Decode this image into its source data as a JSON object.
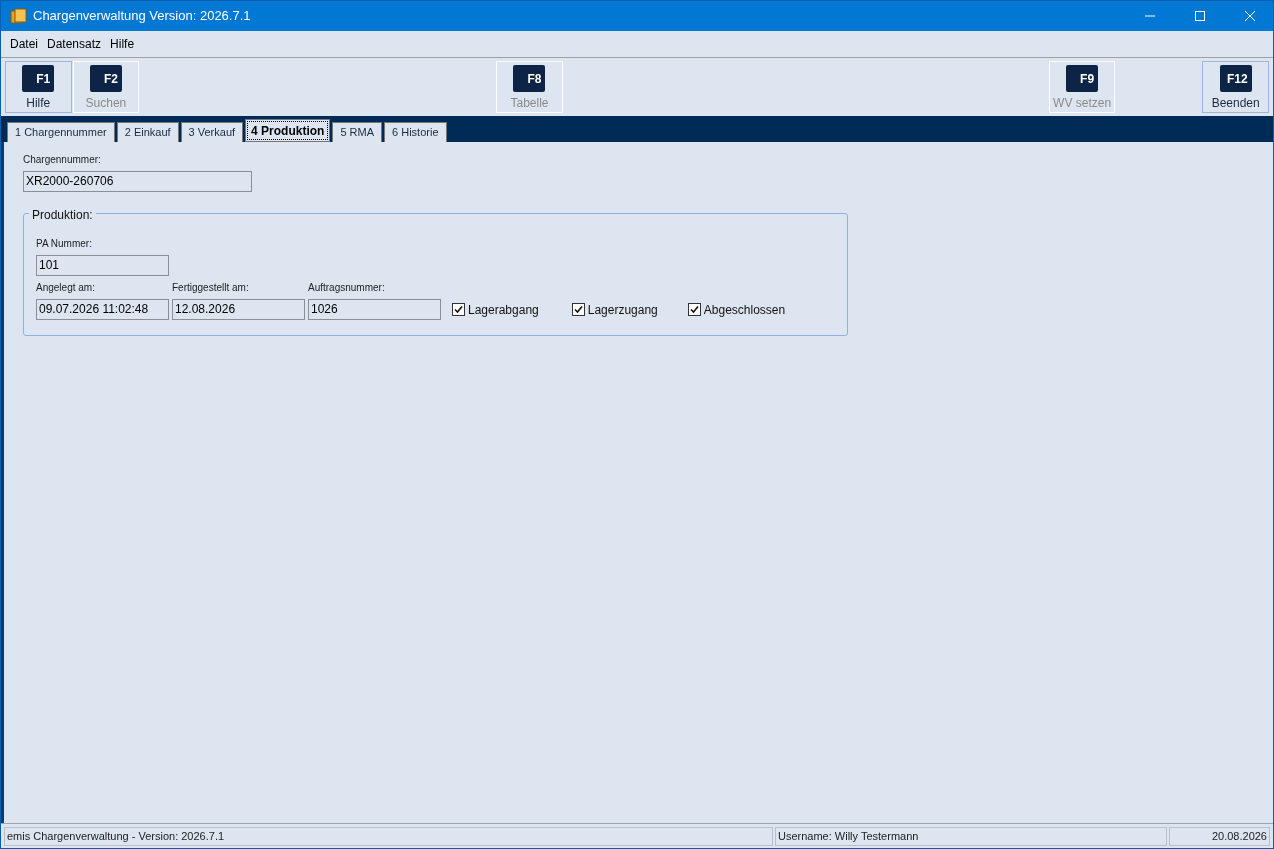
{
  "window": {
    "title": "Chargenverwaltung Version: 2026.7.1"
  },
  "menu": [
    "Datei",
    "Datensatz",
    "Hilfe"
  ],
  "toolbar": [
    {
      "key": "F1",
      "label": "Hilfe",
      "disabled": false
    },
    {
      "key": "F2",
      "label": "Suchen",
      "disabled": true
    },
    {
      "key": "F8",
      "label": "Tabelle",
      "disabled": true
    },
    {
      "key": "F9",
      "label": "WV setzen",
      "disabled": true
    },
    {
      "key": "F12",
      "label": "Beenden",
      "disabled": false
    }
  ],
  "tabs": [
    {
      "label": "1 Chargennummer",
      "selected": false
    },
    {
      "label": "2 Einkauf",
      "selected": false
    },
    {
      "label": "3 Verkauf",
      "selected": false
    },
    {
      "label": "4 Produktion",
      "selected": true
    },
    {
      "label": "5 RMA",
      "selected": false
    },
    {
      "label": "6 Historie",
      "selected": false
    }
  ],
  "chargennummer": {
    "label": "Chargennummer:",
    "value": "XR2000-260706"
  },
  "produktion": {
    "title": "Produktion:",
    "pa_nummer": {
      "label": "PA Nummer:",
      "value": "101"
    },
    "fields": [
      {
        "label": "Angelegt am:",
        "value": "09.07.2026 11:02:48"
      },
      {
        "label": "Fertiggestellt am:",
        "value": "12.08.2026"
      },
      {
        "label": "Auftragsnummer:",
        "value": "1026"
      }
    ],
    "checkboxes": [
      {
        "label": "Lagerabgang",
        "checked": true
      },
      {
        "label": "Lagerzugang",
        "checked": true
      },
      {
        "label": "Abgeschlossen",
        "checked": true
      }
    ]
  },
  "status_bar": {
    "app": "emis Chargenverwaltung - Version: 2026.7.1",
    "user": "Username: Willy Testermann",
    "date": "20.08.2026"
  }
}
